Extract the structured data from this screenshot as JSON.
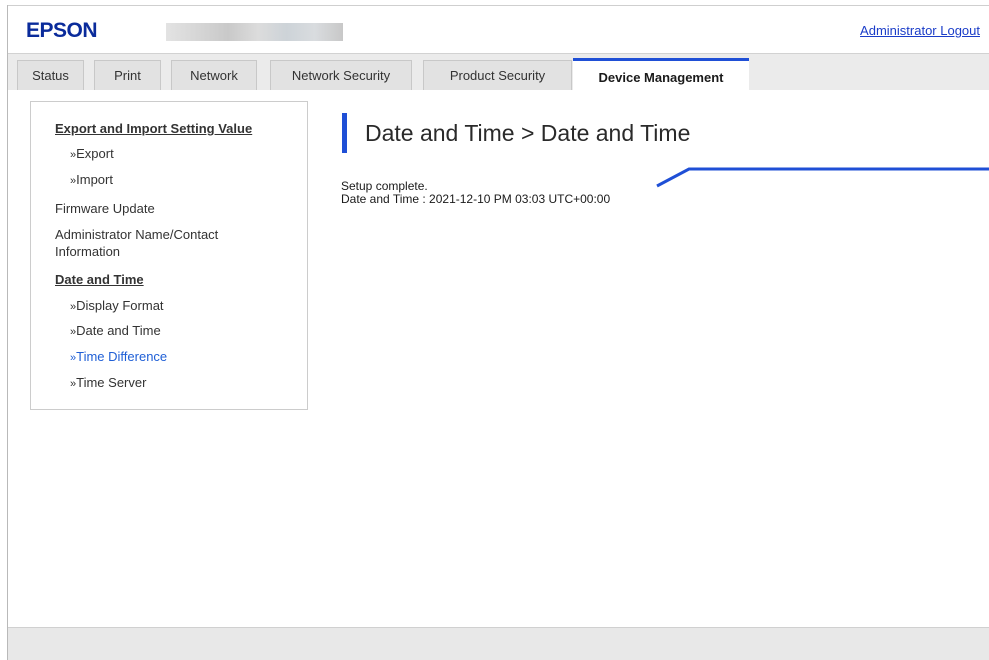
{
  "header": {
    "logo_text": "EPSON",
    "logout_label": "Administrator Logout"
  },
  "tabs": [
    {
      "label": "Status",
      "active": false
    },
    {
      "label": "Print",
      "active": false
    },
    {
      "label": "Network",
      "active": false
    },
    {
      "label": "Network Security",
      "active": false
    },
    {
      "label": "Product Security",
      "active": false
    },
    {
      "label": "Device Management",
      "active": true
    }
  ],
  "sidebar": {
    "items": [
      {
        "label": "Export and Import Setting Value",
        "type": "heading"
      },
      {
        "label": "Export",
        "type": "sub"
      },
      {
        "label": "Import",
        "type": "sub"
      },
      {
        "label": "Firmware Update",
        "type": "item"
      },
      {
        "label": "Administrator Name/Contact Information",
        "type": "item"
      },
      {
        "label": "Date and Time",
        "type": "heading"
      },
      {
        "label": "Display Format",
        "type": "sub"
      },
      {
        "label": "Date and Time",
        "type": "sub"
      },
      {
        "label": "Time Difference",
        "type": "sub",
        "selected": true
      },
      {
        "label": "Time Server",
        "type": "sub"
      }
    ],
    "sub_prefix": "»"
  },
  "main": {
    "title": "Date and Time > Date and Time",
    "status_message": "Setup complete.",
    "datetime_text": "Date and Time : 2021-12-10 PM 03:03 UTC+00:00"
  },
  "colors": {
    "accent": "#1f4fd6",
    "logo": "#0a2b9b",
    "link": "#1a3cc8",
    "callout_line": "#1f4fd6"
  }
}
